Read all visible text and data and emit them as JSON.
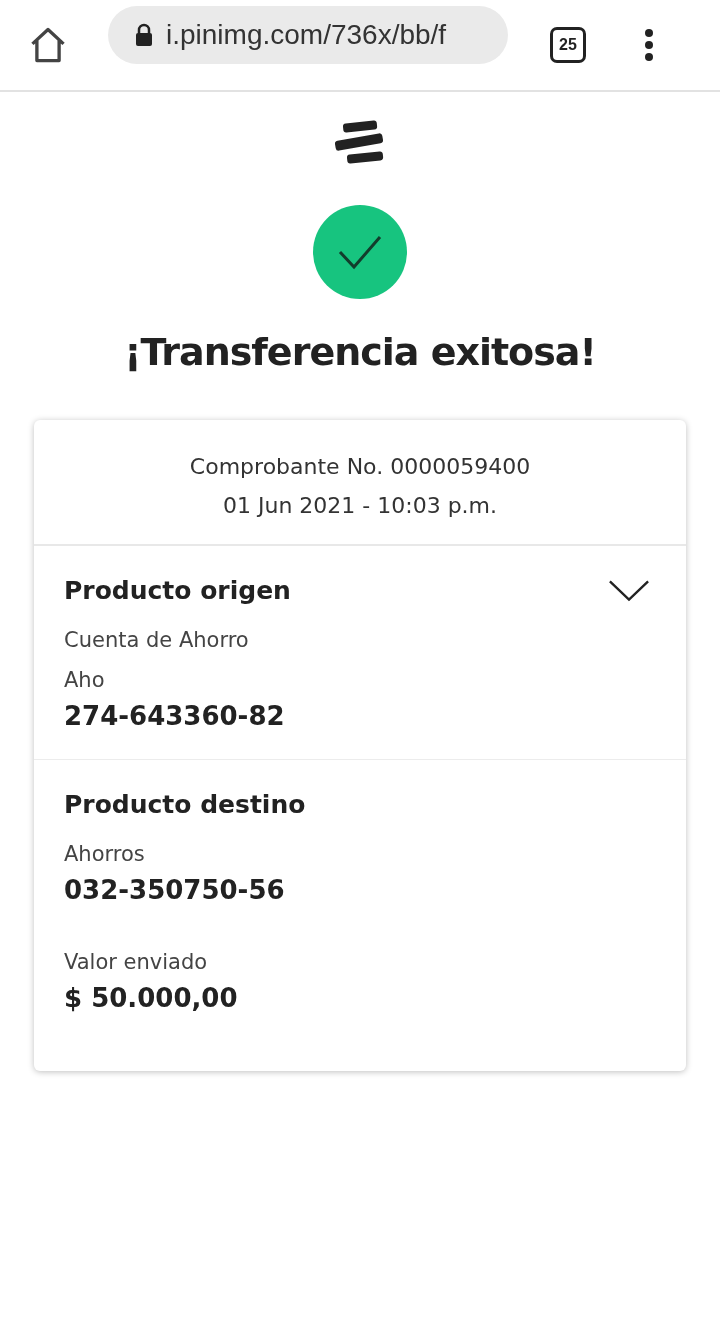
{
  "browser": {
    "url": "i.pinimg.com/736x/bb/f",
    "tab_count": "25"
  },
  "title": "¡Transferencia exitosa!",
  "receipt": {
    "number": "Comprobante No. 0000059400",
    "datetime": "01 Jun 2021 - 10:03 p.m."
  },
  "sections": [
    {
      "title": "Producto origen",
      "collapsible": true,
      "fields": [
        {
          "label": "Cuenta de Ahorro"
        },
        {
          "label": "Aho",
          "value": "274-643360-82"
        }
      ]
    },
    {
      "title": "Producto destino",
      "collapsible": false,
      "fields": [
        {
          "label": "Ahorros",
          "value": "032-350750-56"
        },
        {
          "label": "Valor enviado",
          "value": "$ 50.000,00"
        }
      ]
    }
  ]
}
